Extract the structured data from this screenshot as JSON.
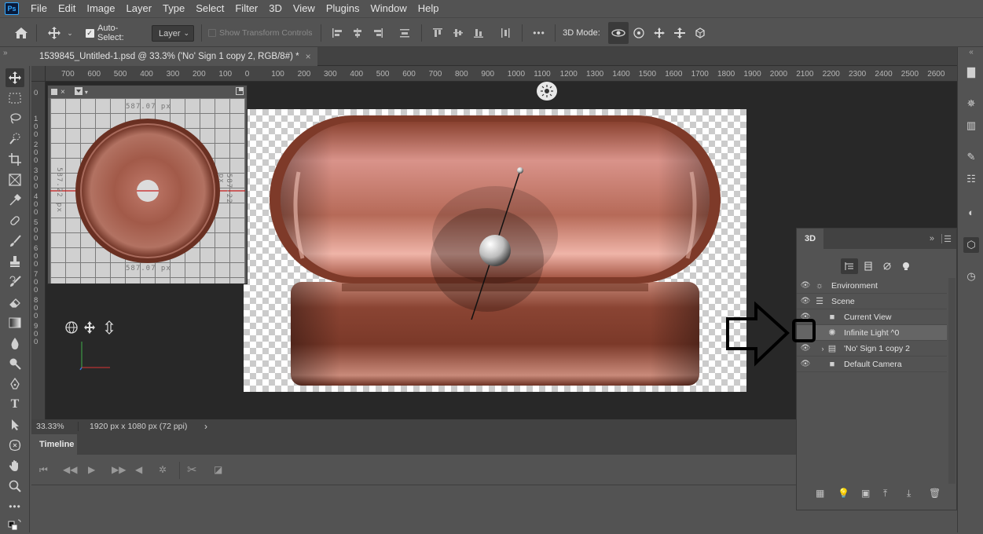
{
  "menubar": {
    "logo": "Ps",
    "items": [
      "File",
      "Edit",
      "Image",
      "Layer",
      "Type",
      "Select",
      "Filter",
      "3D",
      "View",
      "Plugins",
      "Window",
      "Help"
    ]
  },
  "options": {
    "auto_select_label": "Auto-Select:",
    "auto_select_value": "Layer",
    "show_transform_label": "Show Transform Controls",
    "mode_label": "3D Mode:",
    "more": "•••"
  },
  "document": {
    "tab_title": "1539845_Untitled-1.psd @ 33.3% ('No' Sign 1 copy 2, RGB/8#) *",
    "close": "×"
  },
  "ruler": {
    "top": [
      "700",
      "600",
      "500",
      "400",
      "300",
      "200",
      "100",
      "0",
      "100",
      "200",
      "300",
      "400",
      "500",
      "600",
      "700",
      "800",
      "900",
      "1000",
      "1100",
      "1200",
      "1300",
      "1400",
      "1500",
      "1600",
      "1700",
      "1800",
      "1900",
      "2000",
      "2100",
      "2200",
      "2300",
      "2400",
      "2500",
      "2600"
    ],
    "left": [
      "0",
      "1\n0\n0",
      "2\n0\n0",
      "3\n0\n0",
      "4\n0\n0",
      "5\n0\n0",
      "6\n0\n0",
      "7\n0\n0",
      "8\n0\n0",
      "9\n0\n0"
    ]
  },
  "secondary_view": {
    "close": "×",
    "label_top": "587.07 px",
    "label_bottom": "587.07 px",
    "label_left": "587.22 px",
    "label_right": "587.22 px"
  },
  "status": {
    "zoom": "33.33%",
    "doc_info": "1920 px x 1080 px (72 ppi)",
    "arrow": "›"
  },
  "timeline": {
    "tab": "Timeline"
  },
  "panel3d": {
    "tab": "3D",
    "rows": [
      {
        "label": "Environment",
        "icon": "environment-icon",
        "eye": true,
        "selected": false
      },
      {
        "label": "Scene",
        "icon": "scene-icon",
        "eye": true,
        "selected": false
      },
      {
        "label": "Current View",
        "icon": "camera-icon",
        "eye": true,
        "selected": false
      },
      {
        "label": "Infinite Light ^0",
        "icon": "light-icon",
        "eye": false,
        "selected": true
      },
      {
        "label": "'No' Sign 1 copy 2",
        "icon": "mesh-icon",
        "eye": true,
        "selected": false
      },
      {
        "label": "Default Camera",
        "icon": "camera-icon",
        "eye": true,
        "selected": false
      }
    ]
  },
  "colors": {
    "ps_blue": "#31a8ff",
    "ui_bg": "#535353",
    "workspace": "#282828",
    "object_dark": "#7a3a2a",
    "object_light": "#e9a89a"
  }
}
